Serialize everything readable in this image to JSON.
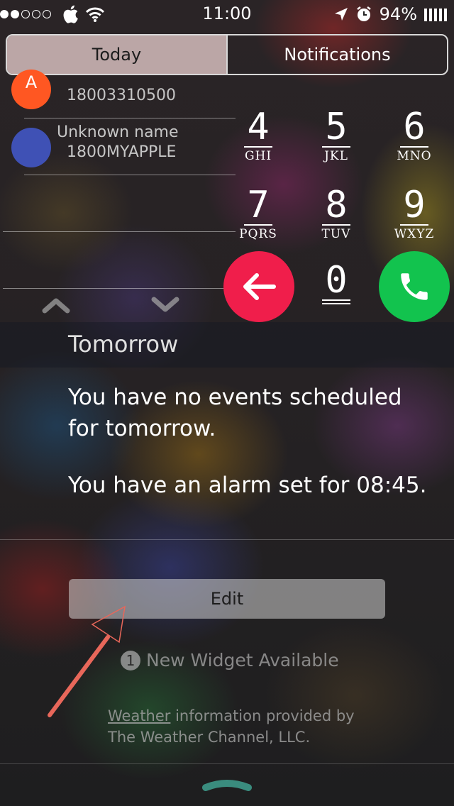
{
  "status_bar": {
    "signal_dots_filled": 2,
    "signal_dots_total": 5,
    "time": "11:00",
    "battery_percent": "94%",
    "icons": [
      "apple-logo-icon",
      "wifi-icon",
      "location-arrow-icon",
      "alarm-icon",
      "battery-bars-icon"
    ]
  },
  "segment": {
    "today_label": "Today",
    "notifications_label": "Notifications",
    "selected": "Today"
  },
  "contacts": [
    {
      "initial": "A",
      "name": "",
      "number": "18003310500",
      "avatar_color": "#ff5722"
    },
    {
      "initial": "",
      "name": "Unknown name",
      "number": "1800MYAPPLE",
      "avatar_color": "#3f51b5"
    }
  ],
  "keypad": {
    "keys": [
      {
        "digit": "4",
        "letters": "GHI"
      },
      {
        "digit": "5",
        "letters": "JKL"
      },
      {
        "digit": "6",
        "letters": "MNO"
      },
      {
        "digit": "7",
        "letters": "PQRS"
      },
      {
        "digit": "8",
        "letters": "TUV"
      },
      {
        "digit": "9",
        "letters": "WXYZ"
      }
    ],
    "zero": "0",
    "backspace_color": "#f01e4b",
    "call_color": "#12c34e"
  },
  "tomorrow": {
    "title": "Tomorrow",
    "events_text": "You have no events scheduled for tomorrow.",
    "alarm_text": "You have an alarm set for 08:45."
  },
  "edit_button": "Edit",
  "new_widget": {
    "count": "1",
    "text": "New Widget Available"
  },
  "weather_credit": {
    "link": "Weather",
    "line1_rest": " information provided by",
    "line2": "The Weather Channel, LLC."
  }
}
